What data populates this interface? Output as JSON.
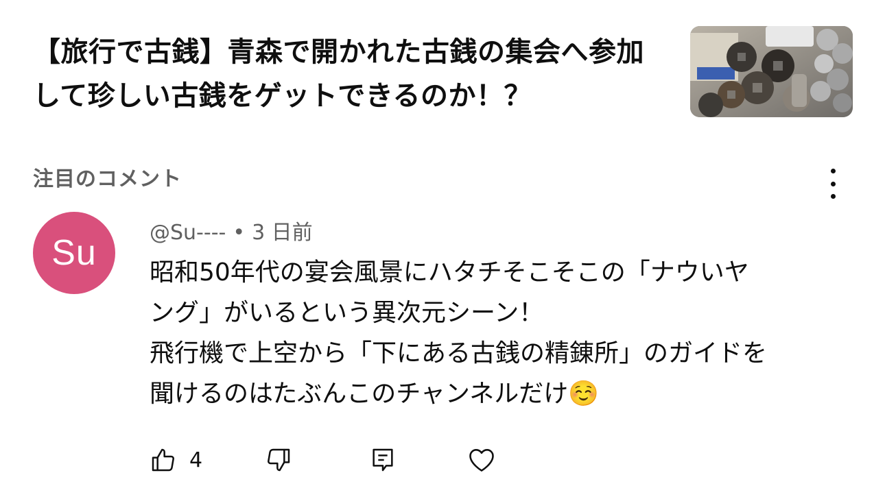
{
  "video": {
    "title": "【旅行で古銭】青森で開かれた古銭の集会へ参加して珍しい古銭をゲットできるのか！？"
  },
  "comments_section": {
    "heading": "注目のコメント"
  },
  "comment": {
    "avatar_initials": "Su",
    "avatar_color": "#d9507c",
    "author": "@Su----",
    "separator": "•",
    "timestamp": "3 日前",
    "lines": [
      "昭和50年代の宴会風景にハタチそこそこの「ナウいヤ",
      "ング」がいるという異次元シーン！",
      "飛行機で上空から「下にある古銭の精錬所」のガイドを",
      "聞けるのはたぶんこのチャンネルだけ☺️"
    ],
    "like_count": "4"
  },
  "icons": {
    "more": "more-vertical-icon",
    "like": "thumbs-up-icon",
    "dislike": "thumbs-down-icon",
    "reply": "reply-icon",
    "heart": "heart-icon"
  }
}
